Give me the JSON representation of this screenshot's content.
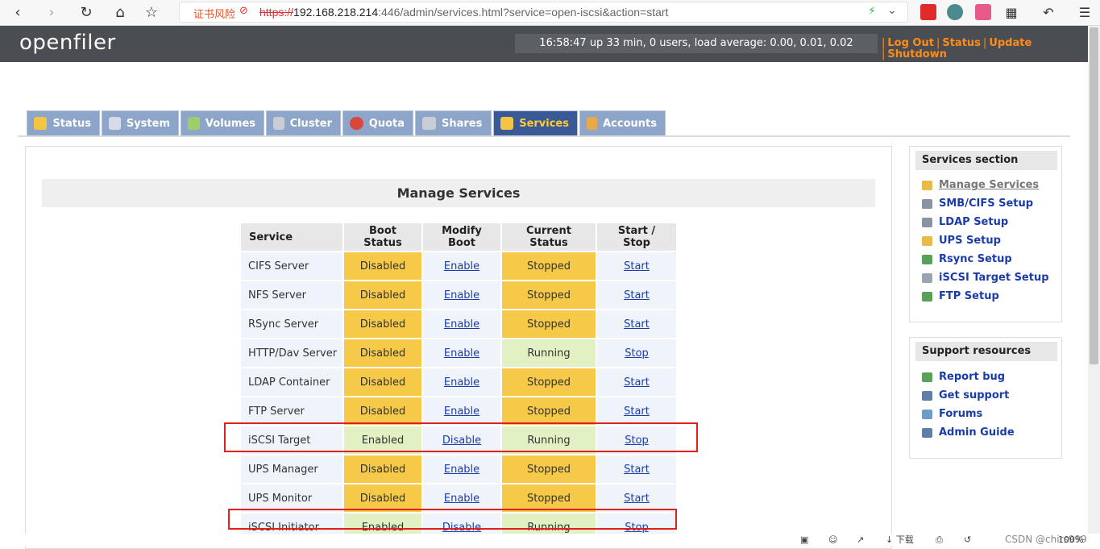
{
  "browser": {
    "security_warning": "证书风险",
    "url_proto": "https://",
    "url_host": "192.168.218.214",
    "url_rest": ":446/admin/services.html?service=open-iscsi&action=start"
  },
  "header": {
    "logo": "openfiler",
    "uptime": "16:58:47 up 33 min, 0 users, load average: 0.00, 0.01, 0.02",
    "links": [
      "Log Out",
      "Status",
      "Update",
      "Shutdown"
    ]
  },
  "tabs": [
    {
      "label": "Status",
      "color": "#f4c542"
    },
    {
      "label": "System",
      "color": "#d6dde8"
    },
    {
      "label": "Volumes",
      "color": "#9ccf6a"
    },
    {
      "label": "Cluster",
      "color": "#c9cdd4"
    },
    {
      "label": "Quota",
      "color": "#d9483b"
    },
    {
      "label": "Shares",
      "color": "#c9cdd4"
    },
    {
      "label": "Services",
      "color": "#f4c542"
    },
    {
      "label": "Accounts",
      "color": "#e9a84a"
    }
  ],
  "main": {
    "title": "Manage Services",
    "table": {
      "headers": [
        "Service",
        "Boot Status",
        "Modify Boot",
        "Current Status",
        "Start / Stop"
      ],
      "rows": [
        {
          "service": "CIFS Server",
          "boot": "Disabled",
          "modify": "Enable",
          "current": "Stopped",
          "action": "Start"
        },
        {
          "service": "NFS Server",
          "boot": "Disabled",
          "modify": "Enable",
          "current": "Stopped",
          "action": "Start"
        },
        {
          "service": "RSync Server",
          "boot": "Disabled",
          "modify": "Enable",
          "current": "Stopped",
          "action": "Start"
        },
        {
          "service": "HTTP/Dav Server",
          "boot": "Disabled",
          "modify": "Enable",
          "current": "Running",
          "action": "Stop"
        },
        {
          "service": "LDAP Container",
          "boot": "Disabled",
          "modify": "Enable",
          "current": "Stopped",
          "action": "Start"
        },
        {
          "service": "FTP Server",
          "boot": "Disabled",
          "modify": "Enable",
          "current": "Stopped",
          "action": "Start"
        },
        {
          "service": "iSCSI Target",
          "boot": "Enabled",
          "modify": "Disable",
          "current": "Running",
          "action": "Stop"
        },
        {
          "service": "UPS Manager",
          "boot": "Disabled",
          "modify": "Enable",
          "current": "Stopped",
          "action": "Start"
        },
        {
          "service": "UPS Monitor",
          "boot": "Disabled",
          "modify": "Enable",
          "current": "Stopped",
          "action": "Start"
        },
        {
          "service": "iSCSI Initiator",
          "boot": "Enabled",
          "modify": "Disable",
          "current": "Running",
          "action": "Stop"
        }
      ]
    }
  },
  "sidebar": {
    "services_title": "Services section",
    "services_items": [
      {
        "label": "Manage Services",
        "color": "#e9b94a"
      },
      {
        "label": "SMB/CIFS Setup",
        "color": "#8a93a3"
      },
      {
        "label": "LDAP Setup",
        "color": "#8a93a3"
      },
      {
        "label": "UPS Setup",
        "color": "#e9b94a"
      },
      {
        "label": "Rsync Setup",
        "color": "#5aa05a"
      },
      {
        "label": "iSCSI Target Setup",
        "color": "#9aa3b0"
      },
      {
        "label": "FTP Setup",
        "color": "#5aa05a"
      }
    ],
    "support_title": "Support resources",
    "support_items": [
      {
        "label": "Report bug",
        "color": "#5aa05a"
      },
      {
        "label": "Get support",
        "color": "#5f7ea8"
      },
      {
        "label": "Forums",
        "color": "#6c9dc5"
      },
      {
        "label": "Admin Guide",
        "color": "#5f7ea8"
      }
    ]
  },
  "statusbar": {
    "download": "下载",
    "watermark": "CSDN @chirs999",
    "zoom": "100%"
  }
}
